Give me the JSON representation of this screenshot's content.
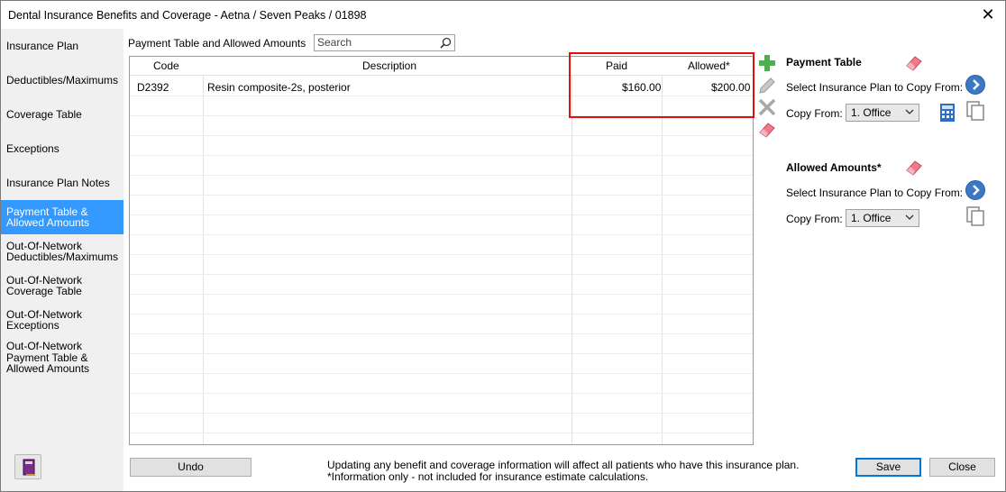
{
  "window": {
    "title": "Dental Insurance Benefits and Coverage - Aetna / Seven Peaks / 01898",
    "close_glyph": "✕"
  },
  "sidebar": {
    "items": [
      {
        "label": "Insurance Plan",
        "active": false
      },
      {
        "label": "Deductibles/Maximums",
        "active": false
      },
      {
        "label": "Coverage Table",
        "active": false
      },
      {
        "label": "Exceptions",
        "active": false
      },
      {
        "label": "Insurance Plan Notes",
        "active": false
      },
      {
        "label": "Payment Table &\nAllowed Amounts",
        "active": true
      },
      {
        "label": "Out-Of-Network\nDeductibles/Maximums",
        "active": false
      },
      {
        "label": "Out-Of-Network\nCoverage Table",
        "active": false
      },
      {
        "label": "Out-Of-Network\nExceptions",
        "active": false
      },
      {
        "label": "Out-Of-Network\nPayment Table &\nAllowed Amounts",
        "active": false
      }
    ],
    "bottom_icon": "book-icon"
  },
  "main": {
    "section_label": "Payment Table and Allowed Amounts",
    "search": {
      "value": "Search",
      "placeholder": "Search"
    },
    "table": {
      "columns": [
        "Code",
        "Description",
        "Paid",
        "Allowed*"
      ],
      "rows": [
        {
          "code": "D2392",
          "description": "Resin composite-2s, posterior",
          "paid": "$160.00",
          "allowed": "$200.00"
        }
      ]
    },
    "tools": [
      "add-icon",
      "edit-icon",
      "delete-icon",
      "eraser-icon"
    ]
  },
  "right_panel": {
    "payment_table": {
      "heading": "Payment Table",
      "select_plan_label": "Select Insurance Plan to Copy From:",
      "copy_from_label": "Copy From:",
      "copy_from_value": "1. Office"
    },
    "allowed_amounts": {
      "heading": "Allowed Amounts*",
      "select_plan_label": "Select Insurance Plan to Copy From:",
      "copy_from_label": "Copy From:",
      "copy_from_value": "1. Office"
    }
  },
  "footer": {
    "undo_label": "Undo",
    "note_line1": "Updating any benefit and coverage information will affect all patients who have this insurance plan.",
    "note_line2": "*Information only - not included for insurance estimate calculations.",
    "save_label": "Save",
    "close_label": "Close"
  },
  "colors": {
    "accent": "#3399ff",
    "highlight_box": "#e01010",
    "add_green": "#4caf50",
    "eraser_pink": "#f07a8a",
    "go_blue": "#3b78c6"
  }
}
